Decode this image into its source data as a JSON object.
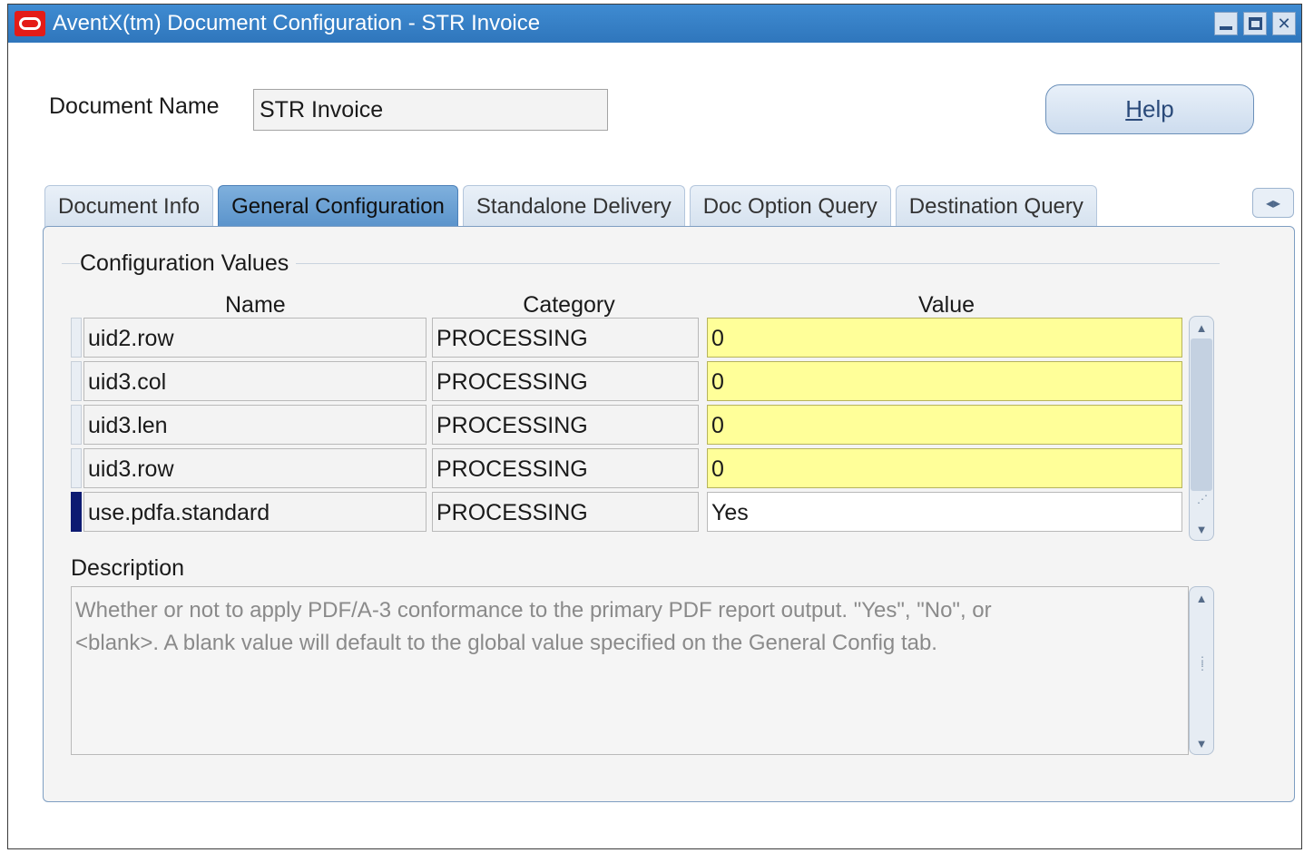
{
  "window": {
    "title": "AventX(tm) Document Configuration - STR Invoice"
  },
  "form": {
    "document_name_label": "Document Name",
    "document_name_value": "STR Invoice",
    "help_button": {
      "mnemonic": "H",
      "rest": "elp"
    }
  },
  "tabs": [
    {
      "label": "Document Info",
      "active": false
    },
    {
      "label": "General Configuration",
      "active": true
    },
    {
      "label": "Standalone Delivery",
      "active": false
    },
    {
      "label": "Doc Option Query",
      "active": false
    },
    {
      "label": "Destination Query",
      "active": false
    }
  ],
  "config_values": {
    "group_title": "Configuration Values",
    "columns": {
      "name": "Name",
      "category": "Category",
      "value": "Value"
    },
    "rows": [
      {
        "name": "uid2.row",
        "category": "PROCESSING",
        "value": "0",
        "highlight": true,
        "current": false
      },
      {
        "name": "uid3.col",
        "category": "PROCESSING",
        "value": "0",
        "highlight": true,
        "current": false
      },
      {
        "name": "uid3.len",
        "category": "PROCESSING",
        "value": "0",
        "highlight": true,
        "current": false
      },
      {
        "name": "uid3.row",
        "category": "PROCESSING",
        "value": "0",
        "highlight": true,
        "current": false
      },
      {
        "name": "use.pdfa.standard",
        "category": "PROCESSING",
        "value": "Yes",
        "highlight": false,
        "current": true
      }
    ]
  },
  "description": {
    "label": "Description",
    "line1": "Whether or not to apply PDF/A-3 conformance to the primary PDF report output.  \"Yes\", \"No\", or",
    "line2": "<blank>.  A blank value will default to the global value specified on the General Config tab."
  },
  "colors": {
    "title_bar": "#2f76bc",
    "required_field": "#ffff99",
    "active_tab": "#5a93cb",
    "current_row_indicator": "#0d1b72"
  }
}
